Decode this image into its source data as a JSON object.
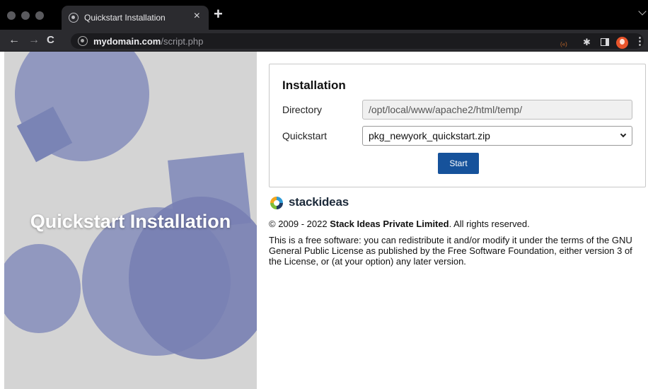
{
  "browser": {
    "tab": {
      "title": "Quickstart Installation",
      "close_glyph": "×",
      "favicon": "globe-icon"
    },
    "new_tab_glyph": "+",
    "nav": {
      "back": "←",
      "forward": "→",
      "reload": "C"
    },
    "url": {
      "host": "mydomain.com",
      "path": "/script.php"
    },
    "toolbar": {
      "radar": "(«)",
      "puzzle": "✱",
      "menu": "⋮"
    }
  },
  "hero": {
    "title": "Quickstart Installation"
  },
  "install": {
    "heading": "Installation",
    "directory_label": "Directory",
    "directory_value": "/opt/local/www/apache2/html/temp/",
    "quickstart_label": "Quickstart",
    "quickstart_value": "pkg_newyork_quickstart.zip",
    "start_label": "Start"
  },
  "footer": {
    "brand": "stackideas",
    "copyright_prefix": "© 2009 - 2022 ",
    "copyright_company": "Stack Ideas Private Limited",
    "copyright_suffix": ". All rights reserved.",
    "license": "This is a free software: you can redistribute it and/or modify it under the terms of the GNU General Public License as published by the Free Software Foundation, either version 3 of the License, or (at your option) any later version."
  },
  "colors": {
    "accent": "#16529b",
    "hero_shape": "#8b93bd",
    "panel_bg": "#d4d4d4"
  }
}
